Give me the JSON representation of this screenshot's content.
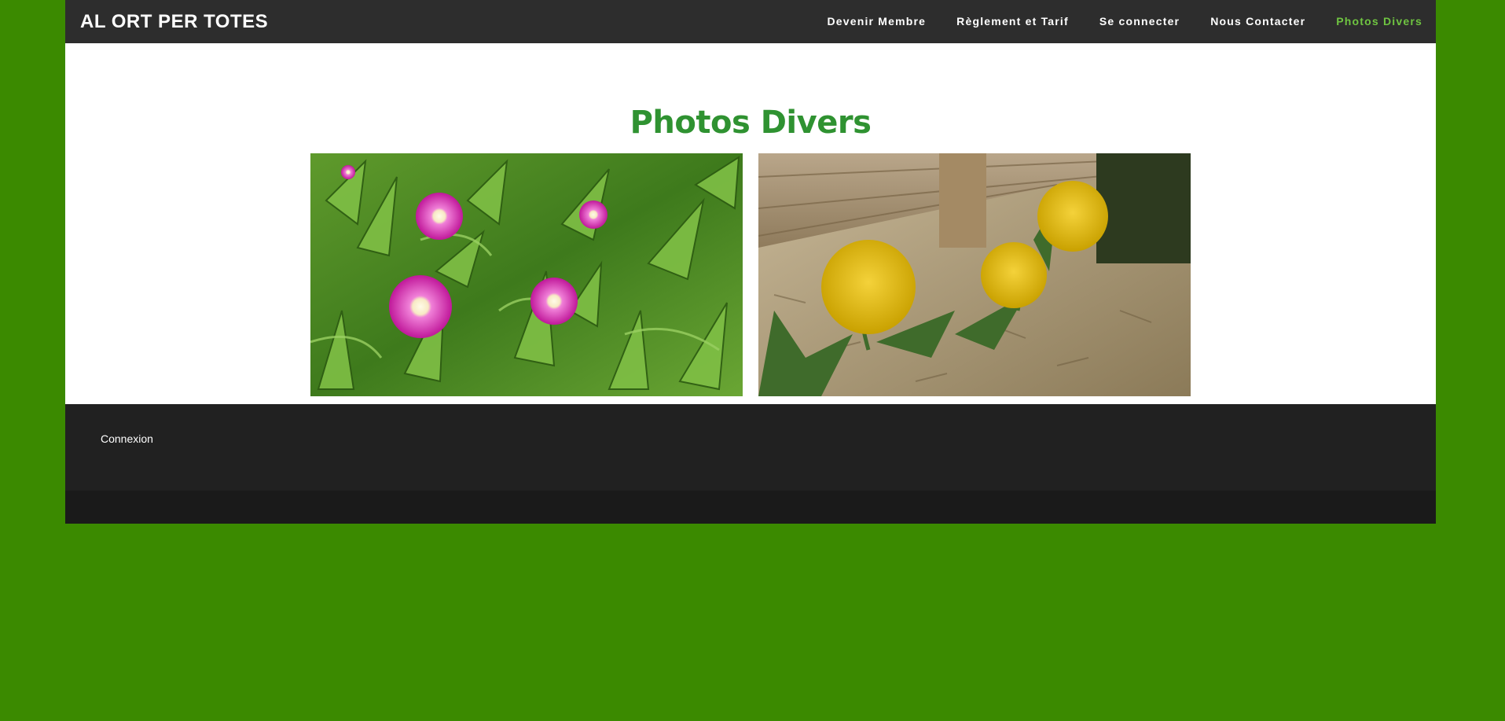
{
  "header": {
    "brand": "AL ORT PER TOTES",
    "nav": [
      {
        "label": "Devenir Membre"
      },
      {
        "label": "Règlement et Tarif"
      },
      {
        "label": "Se connecter"
      },
      {
        "label": "Nous Contacter"
      },
      {
        "label": "Photos Divers"
      }
    ]
  },
  "main": {
    "title": "Photos Divers"
  },
  "footer": {
    "link": "Connexion"
  },
  "colors": {
    "background": "#3b8a00",
    "topbar": "#2d2d2d",
    "nav_active": "#6fc441",
    "title": "#2f9231",
    "footer": "#212121"
  }
}
